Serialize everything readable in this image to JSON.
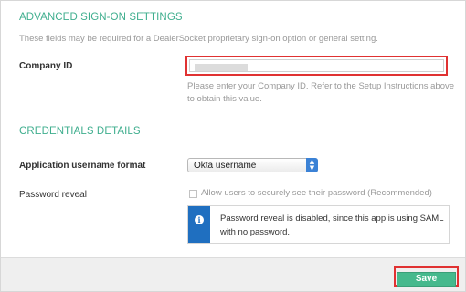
{
  "advanced": {
    "title": "ADVANCED SIGN-ON SETTINGS",
    "description": "These fields may be required for a DealerSocket proprietary sign-on option or general setting.",
    "company_id_label": "Company ID",
    "company_id_value": "",
    "company_id_help_line1": "Please enter your Company ID. Refer to the Setup Instructions above",
    "company_id_help_line2": "to obtain this value."
  },
  "credentials": {
    "title": "CREDENTIALS DETAILS",
    "username_format_label": "Application username format",
    "username_format_selected": "Okta username",
    "password_reveal_label": "Password reveal",
    "password_reveal_checkbox_label": "Allow users to securely see their password (Recommended)",
    "password_reveal_checked": false,
    "notice_line1": "Password reveal is disabled, since this app is using SAML",
    "notice_line2": "with no password.",
    "notice_icon": "info-icon"
  },
  "footer": {
    "save_label": "Save"
  },
  "colors": {
    "accent_green": "#3fae8e",
    "save_green": "#46b98d",
    "highlight_red": "#e03232",
    "info_blue": "#1f6fc0"
  }
}
